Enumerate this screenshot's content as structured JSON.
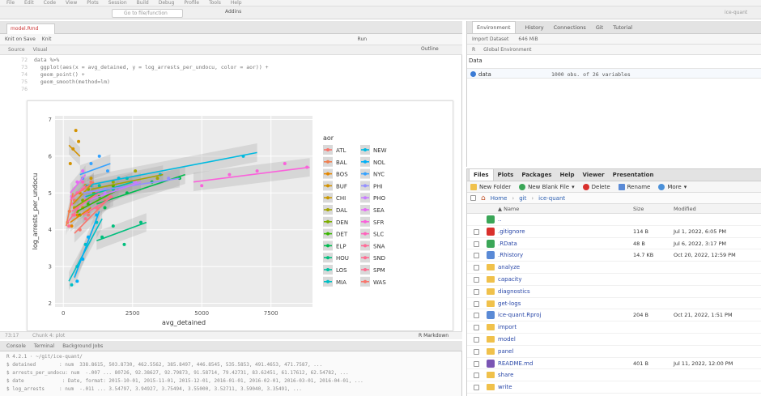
{
  "menubar": {
    "items": [
      "File",
      "Edit",
      "Code",
      "View",
      "Plots",
      "Session",
      "Build",
      "Debug",
      "Profile",
      "Tools",
      "Help"
    ]
  },
  "toolbar": {
    "goto_placeholder": "Go to file/function",
    "addins_label": "Addins",
    "user_label": "ice-quant"
  },
  "editor": {
    "file_tab": "model.Rmd",
    "toolbar_items": [
      "Knit on Save",
      "Knit",
      "Run"
    ],
    "source_tab": "Source",
    "visual_tab": "Visual",
    "outline_label": "Outline",
    "code_lines": [
      {
        "num": "72",
        "text": "data %>%"
      },
      {
        "num": "73",
        "text": "  ggplot(aes(x = avg_detained, y = log_arrests_per_undocu, color = aor)) +"
      },
      {
        "num": "74",
        "text": "  geom_point() +"
      },
      {
        "num": "75",
        "text": "  geom_smooth(method=lm)"
      },
      {
        "num": "76",
        "text": ""
      }
    ],
    "status_left": "73:17",
    "status_chunk": "Chunk 4: plot",
    "status_mode": "R Markdown"
  },
  "console": {
    "tabs": [
      "Console",
      "Terminal",
      "Background Jobs"
    ],
    "path": "R 4.2.1 · ~/git/ice-quant/",
    "lines": [
      "$ detained        : num  338.8615, 503.8730, 462.5562, 385.8497, 446.8545, 535.5853, 491.4653, 471.7587, ...",
      "$ arrests_per_undocu: num  -.007 ... 80726, 92.38627, 92.79873, 91.58714, 79.42731, 83.62451, 61.17612, 62.54782, ...",
      "$ date             : Date, format: 2015-10-01, 2015-11-01, 2015-12-01, 2016-01-01, 2016-02-01, 2016-03-01, 2016-04-01, ...",
      "$ log_arrests     : num  -.011 ... 3.54797, 3.94927, 3.75494, 3.55000, 3.52711, 3.59040, 3.35491, ..."
    ]
  },
  "environment": {
    "tabs": [
      "Environment",
      "History",
      "Connections",
      "Git",
      "Tutorial"
    ],
    "import_label": "Import Dataset",
    "memory_label": "646 MiB",
    "lang_label": "R",
    "scope_label": "Global Environment",
    "section_header": "Data",
    "rows": [
      {
        "name": "data",
        "desc": "1000 obs. of 26 variables"
      }
    ]
  },
  "files": {
    "tabs": [
      "Files",
      "Plots",
      "Packages",
      "Help",
      "Viewer",
      "Presentation"
    ],
    "toolbar": {
      "new_folder": "New Folder",
      "new_blank": "New Blank File",
      "delete": "Delete",
      "rename": "Rename",
      "more": "More"
    },
    "breadcrumb": [
      "Home",
      "git",
      "ice-quant"
    ],
    "columns": {
      "name": "Name",
      "size": "Size",
      "modified": "Modified"
    },
    "rows": [
      {
        "name": "..",
        "size": "",
        "modified": "",
        "icon": "up-arrow-icon"
      },
      {
        "name": ".gitignore",
        "size": "114 B",
        "modified": "Jul 1, 2022, 6:05 PM",
        "icon": "gitignore-file-icon"
      },
      {
        "name": ".RData",
        "size": "48 B",
        "modified": "Jul 6, 2022, 3:17 PM",
        "icon": "rdata-file-icon"
      },
      {
        "name": ".Rhistory",
        "size": "14.7 KB",
        "modified": "Oct 20, 2022, 12:59 PM",
        "icon": "rhistory-file-icon"
      },
      {
        "name": "analyze",
        "size": "",
        "modified": "",
        "icon": "folder-icon"
      },
      {
        "name": "capacity",
        "size": "",
        "modified": "",
        "icon": "folder-icon"
      },
      {
        "name": "diagnostics",
        "size": "",
        "modified": "",
        "icon": "folder-icon"
      },
      {
        "name": "get-logs",
        "size": "",
        "modified": "",
        "icon": "folder-icon"
      },
      {
        "name": "ice-quant.Rproj",
        "size": "204 B",
        "modified": "Oct 21, 2022, 1:51 PM",
        "icon": "rproj-file-icon"
      },
      {
        "name": "import",
        "size": "",
        "modified": "",
        "icon": "folder-icon"
      },
      {
        "name": "model",
        "size": "",
        "modified": "",
        "icon": "folder-icon"
      },
      {
        "name": "panel",
        "size": "",
        "modified": "",
        "icon": "folder-icon"
      },
      {
        "name": "README.md",
        "size": "401 B",
        "modified": "Jul 11, 2022, 12:00 PM",
        "icon": "markdown-file-icon"
      },
      {
        "name": "share",
        "size": "",
        "modified": "",
        "icon": "folder-icon"
      },
      {
        "name": "write",
        "size": "",
        "modified": "",
        "icon": "folder-icon"
      }
    ]
  },
  "chart_data": {
    "type": "scatter",
    "title": "",
    "xlabel": "avg_detained",
    "ylabel": "log_arrests_per_undocu",
    "xlim": [
      -300,
      9000
    ],
    "ylim": [
      1.9,
      7.1
    ],
    "x_ticks": [
      0,
      2500,
      5000,
      7500
    ],
    "x_tick_labels": [
      "0",
      "2500",
      "5000",
      "7500"
    ],
    "y_ticks": [
      2,
      3,
      4,
      5,
      6,
      7
    ],
    "y_tick_labels": [
      "2",
      "3",
      "4",
      "5",
      "6",
      "7"
    ],
    "grid": true,
    "legend_title": "aor",
    "legend_position": "right",
    "series": [
      {
        "name": "ATL",
        "color": "#F8766D",
        "x": [
          600,
          900,
          1200,
          1500
        ],
        "y": [
          4.0,
          4.4,
          4.6,
          4.8
        ],
        "trend": [
          [
            400,
            3.9
          ],
          [
            1700,
            4.9
          ]
        ]
      },
      {
        "name": "BAL",
        "color": "#F07F4F",
        "x": [
          150,
          220,
          300
        ],
        "y": [
          4.2,
          4.5,
          4.9
        ],
        "trend": [
          [
            100,
            4.1
          ],
          [
            350,
            5.0
          ]
        ]
      },
      {
        "name": "BOS",
        "color": "#E58700",
        "x": [
          300,
          500,
          700,
          900
        ],
        "y": [
          4.1,
          4.4,
          4.6,
          4.5
        ],
        "trend": [
          [
            250,
            4.2
          ],
          [
            1000,
            4.6
          ]
        ]
      },
      {
        "name": "BUF",
        "color": "#D39200",
        "x": [
          250,
          350,
          450,
          550
        ],
        "y": [
          5.8,
          6.2,
          6.7,
          6.4
        ],
        "trend": [
          [
            200,
            6.3
          ],
          [
            600,
            6.0
          ]
        ]
      },
      {
        "name": "CHI",
        "color": "#C99800",
        "x": [
          400,
          600,
          800,
          1000
        ],
        "y": [
          4.6,
          5.0,
          5.2,
          5.4
        ],
        "trend": [
          [
            350,
            4.7
          ],
          [
            1100,
            5.3
          ]
        ]
      },
      {
        "name": "DAL",
        "color": "#A3A500",
        "x": [
          1200,
          1800,
          2600,
          3400
        ],
        "y": [
          5.0,
          5.3,
          5.6,
          5.4
        ],
        "trend": [
          [
            1000,
            5.1
          ],
          [
            3600,
            5.5
          ]
        ]
      },
      {
        "name": "DEN",
        "color": "#7CAE00",
        "x": [
          500,
          700,
          900,
          1100
        ],
        "y": [
          4.5,
          4.8,
          5.1,
          5.0
        ],
        "trend": [
          [
            400,
            4.6
          ],
          [
            1200,
            5.0
          ]
        ]
      },
      {
        "name": "DET",
        "color": "#39B600",
        "x": [
          600,
          900,
          1300,
          1800
        ],
        "y": [
          4.4,
          4.7,
          4.9,
          5.2
        ],
        "trend": [
          [
            500,
            4.5
          ],
          [
            2000,
            5.1
          ]
        ]
      },
      {
        "name": "ELP",
        "color": "#00BB4E",
        "x": [
          1500,
          2300,
          3200,
          4200
        ],
        "y": [
          4.6,
          5.0,
          5.3,
          5.4
        ],
        "trend": [
          [
            1200,
            4.7
          ],
          [
            4400,
            5.5
          ]
        ]
      },
      {
        "name": "HOU",
        "color": "#00BF7D",
        "x": [
          1400,
          1800,
          2200,
          2800
        ],
        "y": [
          3.8,
          4.1,
          3.6,
          4.2
        ],
        "trend": [
          [
            1200,
            3.7
          ],
          [
            3000,
            4.2
          ]
        ]
      },
      {
        "name": "LOS",
        "color": "#00C1A3",
        "x": [
          900,
          1300,
          1800,
          2300
        ],
        "y": [
          4.8,
          5.2,
          5.1,
          5.4
        ],
        "trend": [
          [
            800,
            4.9
          ],
          [
            2500,
            5.3
          ]
        ]
      },
      {
        "name": "MIA",
        "color": "#00BFC4",
        "x": [
          300,
          500,
          800,
          1200
        ],
        "y": [
          2.5,
          3.0,
          3.6,
          4.2
        ],
        "trend": [
          [
            200,
            2.6
          ],
          [
            1400,
            4.3
          ]
        ]
      },
      {
        "name": "NEW",
        "color": "#00BAE0",
        "x": [
          1000,
          2000,
          3500,
          6500
        ],
        "y": [
          5.2,
          5.4,
          5.5,
          6.0
        ],
        "trend": [
          [
            800,
            5.2
          ],
          [
            7000,
            6.1
          ]
        ]
      },
      {
        "name": "NOL",
        "color": "#00B0F6",
        "x": [
          500,
          700,
          900,
          1200
        ],
        "y": [
          2.6,
          3.2,
          3.8,
          4.4
        ],
        "trend": [
          [
            400,
            2.7
          ],
          [
            1300,
            4.5
          ]
        ]
      },
      {
        "name": "NYC",
        "color": "#35A2FF",
        "x": [
          700,
          1000,
          1300,
          1600
        ],
        "y": [
          5.4,
          5.8,
          6.0,
          5.6
        ],
        "trend": [
          [
            600,
            5.5
          ],
          [
            1700,
            5.8
          ]
        ]
      },
      {
        "name": "PHI",
        "color": "#9590FF",
        "x": [
          800,
          1500,
          2500,
          3800
        ],
        "y": [
          4.9,
          5.1,
          5.3,
          5.4
        ],
        "trend": [
          [
            700,
            5.0
          ],
          [
            4200,
            5.4
          ]
        ]
      },
      {
        "name": "PHO",
        "color": "#C77CFF",
        "x": [
          1000,
          1500,
          2000,
          2600
        ],
        "y": [
          4.7,
          5.0,
          5.2,
          5.3
        ],
        "trend": [
          [
            900,
            4.8
          ],
          [
            2800,
            5.3
          ]
        ]
      },
      {
        "name": "SEA",
        "color": "#E76BF3",
        "x": [
          300,
          500,
          700
        ],
        "y": [
          4.9,
          5.3,
          5.6
        ],
        "trend": [
          [
            250,
            5.0
          ],
          [
            800,
            5.5
          ]
        ]
      },
      {
        "name": "SFR",
        "color": "#FA62DB",
        "x": [
          5000,
          6000,
          7000,
          8000,
          8800
        ],
        "y": [
          5.2,
          5.5,
          5.6,
          5.8,
          5.7
        ],
        "trend": [
          [
            4700,
            5.3
          ],
          [
            8900,
            5.7
          ]
        ]
      },
      {
        "name": "SLC",
        "color": "#FF62BC",
        "x": [
          300,
          500,
          700
        ],
        "y": [
          4.7,
          5.0,
          5.3
        ],
        "trend": [
          [
            250,
            4.8
          ],
          [
            800,
            5.2
          ]
        ]
      },
      {
        "name": "SNA",
        "color": "#FF6A98",
        "x": [
          400,
          800,
          1200
        ],
        "y": [
          4.4,
          4.8,
          5.0
        ],
        "trend": [
          [
            300,
            4.5
          ],
          [
            1300,
            5.0
          ]
        ]
      },
      {
        "name": "SND",
        "color": "#FF6C91",
        "x": [
          800,
          1200,
          1700
        ],
        "y": [
          4.3,
          4.6,
          4.9
        ],
        "trend": [
          [
            700,
            4.4
          ],
          [
            1800,
            4.9
          ]
        ]
      },
      {
        "name": "SPM",
        "color": "#FF6C91",
        "x": [
          200,
          350,
          500
        ],
        "y": [
          4.1,
          4.4,
          4.6
        ],
        "trend": [
          [
            150,
            4.2
          ],
          [
            550,
            4.6
          ]
        ]
      },
      {
        "name": "WAS",
        "color": "#F8766D",
        "x": [
          400,
          700,
          1000
        ],
        "y": [
          4.8,
          5.1,
          5.3
        ],
        "trend": [
          [
            350,
            4.9
          ],
          [
            1100,
            5.3
          ]
        ]
      }
    ]
  }
}
